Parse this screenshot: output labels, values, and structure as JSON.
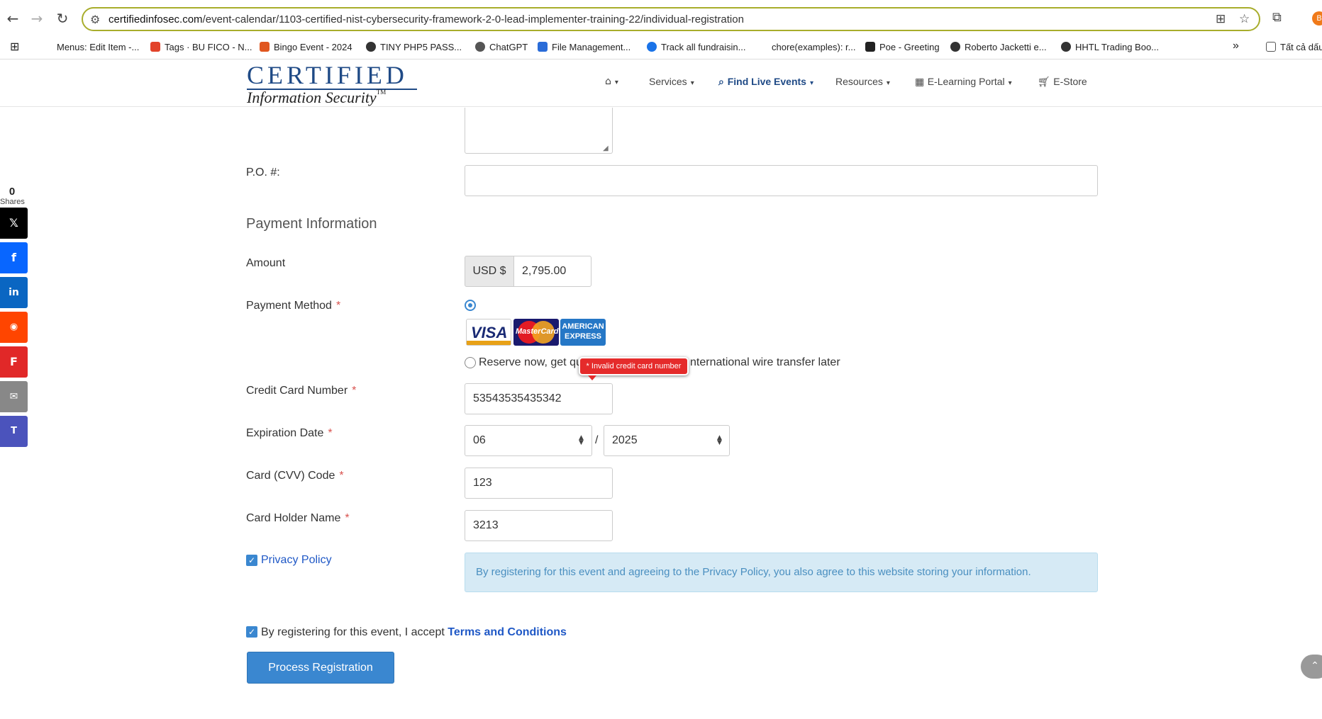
{
  "browser": {
    "url_domain": "certifiedinfosec.com",
    "url_path": "/event-calendar/1103-certified-nist-cybersecurity-framework-2-0-lead-implementer-training-22/individual-registration",
    "profile_initial": "B",
    "bookmarks": [
      {
        "label": "Menus: Edit Item -...",
        "color": "#ffffff"
      },
      {
        "label": "Tags · BU FICO - N...",
        "color": "#e2432a"
      },
      {
        "label": "Bingo Event - 2024",
        "color": "#e0561f"
      },
      {
        "label": "TINY PHP5 PASS...",
        "color": "#333333"
      },
      {
        "label": "ChatGPT",
        "color": "#555555"
      },
      {
        "label": "File Management...",
        "color": "#2a6cd8"
      },
      {
        "label": "Track all fundraisin...",
        "color": "#1a73e8"
      },
      {
        "label": "chore(examples): r...",
        "color": "#ffffff"
      },
      {
        "label": "Poe - Greeting",
        "color": "#222222"
      },
      {
        "label": "Roberto Jacketti e...",
        "color": "#333333"
      },
      {
        "label": "HHTL Trading Boo...",
        "color": "#333333"
      }
    ],
    "more_bookmarks": "»",
    "all_bookmarks": "Tất cả dấu"
  },
  "site": {
    "logo_top": "CERTIFIED",
    "logo_bottom": "Information Security",
    "logo_tm": "TM",
    "nav": [
      {
        "label": "",
        "icon": "home-icon"
      },
      {
        "label": "Services"
      },
      {
        "label": "Find Live Events",
        "icon": "search-icon",
        "active": true
      },
      {
        "label": "Resources"
      },
      {
        "label": "E-Learning Portal",
        "icon": "classroom-icon"
      },
      {
        "label": "E-Store",
        "icon": "cart-icon"
      }
    ]
  },
  "share": {
    "count": "0",
    "label": "Shares",
    "buttons": [
      {
        "name": "x",
        "glyph": "𝕏",
        "color": "#000000"
      },
      {
        "name": "facebook",
        "glyph": "f",
        "color": "#0866ff"
      },
      {
        "name": "linkedin",
        "glyph": "in",
        "color": "#0a66c2"
      },
      {
        "name": "reddit",
        "glyph": "◉",
        "color": "#ff4500"
      },
      {
        "name": "flipboard",
        "glyph": "F",
        "color": "#e12828"
      },
      {
        "name": "email",
        "glyph": "✉",
        "color": "#888888"
      },
      {
        "name": "teams",
        "glyph": "T",
        "color": "#4b53bc"
      }
    ]
  },
  "form": {
    "po_label": "P.O. #:",
    "po_value": "",
    "payment_section_title": "Payment Information",
    "amount_label": "Amount",
    "currency": "USD $",
    "amount_value": "2,795.00",
    "payment_method_label": "Payment Method",
    "required_mark": "*",
    "cards": {
      "visa": "VISA",
      "mastercard": "MasterCard",
      "amex_line1": "AMERICAN",
      "amex_line2": "EXPRESS"
    },
    "reserve_option_prefix": "Reserve now, get qu",
    "reserve_option_suffix": "nternational wire transfer later",
    "tooltip_error": "* Invalid credit card number",
    "cc_number_label": "Credit Card Number",
    "cc_number_value": "53543535435342",
    "expiration_label": "Expiration Date",
    "exp_month": "06",
    "exp_separator": "/",
    "exp_year": "2025",
    "cvv_label": "Card (CVV) Code",
    "cvv_value": "123",
    "holder_label": "Card Holder Name",
    "holder_value": "3213",
    "privacy_label": "Privacy Policy",
    "privacy_notice": "By registering for this event and agreeing to the Privacy Policy, you also agree to this website storing your information.",
    "terms_prefix": "By registering for this event, I accept ",
    "terms_link": "Terms and Conditions",
    "submit_label": "Process Registration"
  },
  "colors": {
    "accent": "#3a87d0",
    "brand": "#1f4a86",
    "error": "#e52b2b",
    "notice_bg": "#d6eaf5"
  }
}
